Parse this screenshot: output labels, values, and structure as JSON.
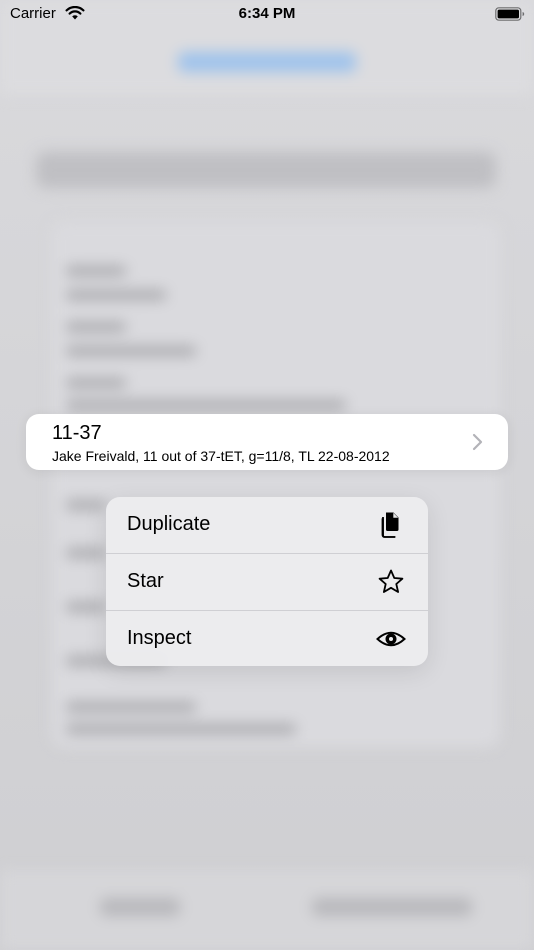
{
  "status_bar": {
    "carrier": "Carrier",
    "time": "6:34 PM",
    "wifi_icon": "wifi-icon",
    "battery_icon": "battery-icon"
  },
  "highlighted_row": {
    "title": "11-37",
    "subtitle": "Jake Freivald, 11 out of 37-tET, g=11/8, TL 22-08-2012",
    "chevron_icon": "chevron-right-icon"
  },
  "context_menu": {
    "items": [
      {
        "label": "Duplicate",
        "icon": "duplicate-icon"
      },
      {
        "label": "Star",
        "icon": "star-icon"
      },
      {
        "label": "Inspect",
        "icon": "eye-icon"
      }
    ]
  },
  "colors": {
    "accent": "#007aff",
    "menu_background": "#ececee",
    "row_background": "#ffffff"
  }
}
